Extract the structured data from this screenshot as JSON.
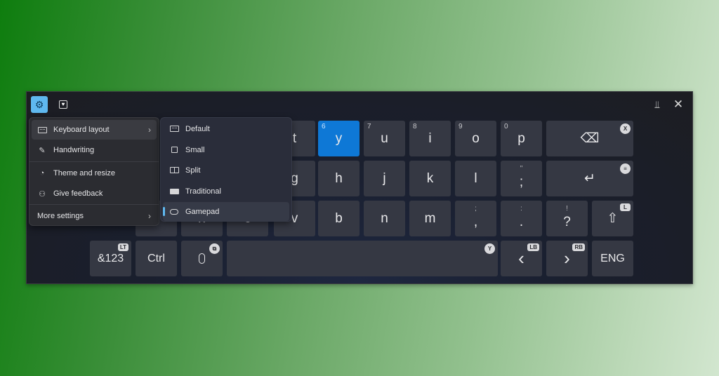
{
  "titlebar": {
    "settings_icon": "gear-icon",
    "emoji_icon": "emoji-heart-icon",
    "dock_icon": "dock-icon",
    "close_icon": "close-icon",
    "settings_glyph": "⚙",
    "emoji_glyph": "♥",
    "dock_glyph": "⫫",
    "close_glyph": "✕"
  },
  "menu": {
    "items": [
      {
        "label": "Keyboard layout",
        "icon": "keyboard-icon",
        "has_submenu": true
      },
      {
        "label": "Handwriting",
        "icon": "handwriting-icon"
      },
      {
        "label": "Theme and resize",
        "icon": "palette-icon"
      },
      {
        "label": "Give feedback",
        "icon": "feedback-icon"
      },
      {
        "label": "More settings",
        "has_submenu": true
      }
    ],
    "chevron": "›"
  },
  "submenu": {
    "items": [
      {
        "label": "Default",
        "icon": "keyboard-default-icon"
      },
      {
        "label": "Small",
        "icon": "keyboard-small-icon"
      },
      {
        "label": "Split",
        "icon": "keyboard-split-icon"
      },
      {
        "label": "Traditional",
        "icon": "keyboard-traditional-icon"
      },
      {
        "label": "Gamepad",
        "icon": "gamepad-icon",
        "selected": true
      }
    ]
  },
  "keyboard": {
    "accent_color": "#0e78d6",
    "row1": [
      {
        "label": "t"
      },
      {
        "label": "y",
        "num": "6",
        "active": true
      },
      {
        "label": "u",
        "num": "7"
      },
      {
        "label": "i",
        "num": "8"
      },
      {
        "label": "o",
        "num": "9"
      },
      {
        "label": "p",
        "num": "0"
      }
    ],
    "backspace": {
      "glyph": "⌫",
      "hint": "X"
    },
    "row2": [
      {
        "label": "g"
      },
      {
        "label": "h"
      },
      {
        "label": "j"
      },
      {
        "label": "k"
      },
      {
        "label": "l"
      },
      {
        "label": ";",
        "secondary": "\""
      }
    ],
    "enter": {
      "glyph": "↵",
      "hint": "≡"
    },
    "row3": [
      {
        "label": "x"
      },
      {
        "label": "c"
      },
      {
        "label": "v"
      },
      {
        "label": "b"
      },
      {
        "label": "n"
      },
      {
        "label": "m"
      },
      {
        "label": ",",
        "secondary": ";"
      },
      {
        "label": ".",
        "secondary": ":"
      },
      {
        "label": "?",
        "secondary": "!"
      }
    ],
    "shift": {
      "glyph": "⇧",
      "hint": "L"
    },
    "row4": {
      "symbols": {
        "label": "&123",
        "hint": "LT"
      },
      "ctrl": {
        "label": "Ctrl"
      },
      "mic": {
        "glyph": "🎙",
        "hint": "⧉"
      },
      "space": {
        "hint": "Y"
      },
      "left": {
        "glyph": "‹",
        "hint": "LB"
      },
      "right": {
        "glyph": "›",
        "hint": "RB"
      },
      "lang": {
        "label": "ENG"
      }
    }
  }
}
